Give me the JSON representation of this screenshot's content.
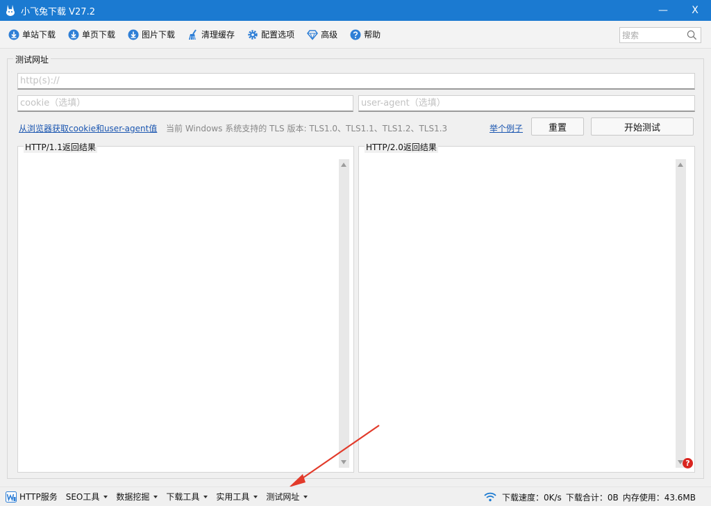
{
  "window": {
    "title": "小飞兔下载 V27.2",
    "minimize": "—",
    "close": "X"
  },
  "toolbar": {
    "items": [
      {
        "label": "单站下载",
        "icon": "cloud-download-icon"
      },
      {
        "label": "单页下载",
        "icon": "cloud-download-icon"
      },
      {
        "label": "图片下载",
        "icon": "cloud-download-icon"
      },
      {
        "label": "清理缓存",
        "icon": "broom-icon"
      },
      {
        "label": "配置选项",
        "icon": "gear-icon"
      },
      {
        "label": "高级",
        "icon": "diamond-icon"
      },
      {
        "label": "帮助",
        "icon": "help-icon"
      }
    ],
    "search_placeholder": "搜索"
  },
  "main": {
    "group_title": "测试网址",
    "url_placeholder": "http(s)://",
    "cookie_placeholder": "cookie（选填）",
    "ua_placeholder": "user-agent（选填）",
    "browser_link": "从浏览器获取cookie和user-agent值",
    "tls_info": "当前 Windows 系统支持的 TLS 版本: TLS1.0、TLS1.1、TLS1.2、TLS1.3",
    "example_link": "举个例子",
    "reset_button": "重置",
    "start_button": "开始测试",
    "http11_title": "HTTP/1.1返回结果",
    "http20_title": "HTTP/2.0返回结果",
    "help_badge": "?"
  },
  "statusbar": {
    "menus": [
      {
        "label": "HTTP服务",
        "caret": false
      },
      {
        "label": "SEO工具",
        "caret": true
      },
      {
        "label": "数据挖掘",
        "caret": true
      },
      {
        "label": "下载工具",
        "caret": true
      },
      {
        "label": "实用工具",
        "caret": true
      },
      {
        "label": "测试网址",
        "caret": true
      }
    ],
    "speed": "下载速度：0K/s",
    "total": "下载合计：0B",
    "memory": "内存使用：43.6MB"
  },
  "colors": {
    "titlebar": "#1b7ad1",
    "accent": "#1b56b0",
    "annotation_arrow": "#e23a2a"
  }
}
